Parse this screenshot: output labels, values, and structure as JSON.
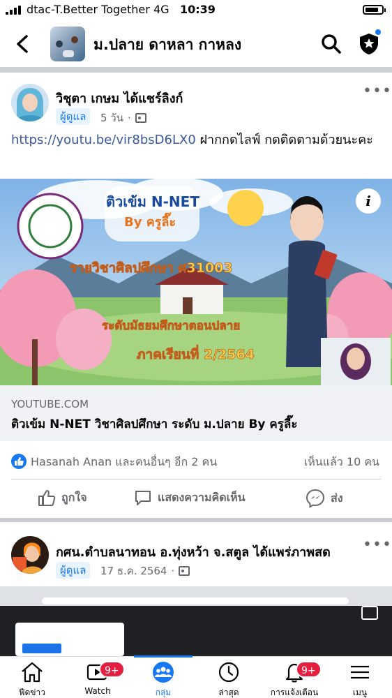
{
  "status_bar": {
    "carrier": "dtac-T.Better Together",
    "network": "4G",
    "time": "10:39"
  },
  "header": {
    "group_name": "ม.ปลาย ดาหลา กาหลง",
    "icons": [
      "back-arrow-icon",
      "search-icon",
      "admin-shield-icon"
    ]
  },
  "posts": [
    {
      "author": "วิชุตา เกษม",
      "action": "ได้แชร์ลิงก์",
      "badge": "ผู้ดูแล",
      "time": "5 วัน",
      "link_text": "https://youtu.be/vir8bsD6LX0",
      "text": " ฝากกดไลฟ์ กดติดตามด้วยนะคะ",
      "thumbnail": {
        "title": "ติวเข้ม N-NET",
        "subtitle": "By ครูลี๊ะ",
        "course": "รายวิชาศิลปศึกษา ศ31003",
        "level": "ระดับมัธยมศึกษาตอนปลาย",
        "term": "ภาคเรียนที่ 2/2564"
      },
      "link_domain": "YOUTUBE.COM",
      "link_title": "ติวเข้ม N-NET วิชาศิลปศึกษา ระดับ ม.ปลาย By ครูลี๊ะ",
      "reactions_text": "Hasanah Anan และคนอื่นๆ อีก 2 คน",
      "views_text": "เห็นแล้ว 10 คน",
      "actions": {
        "like": "ถูกใจ",
        "comment": "แสดงความคิดเห็น",
        "share": "ส่ง"
      }
    },
    {
      "author": "กศน.ตำบลนาทอน อ.ทุ่งหว้า จ.สตูล",
      "action": "ได้แพร่ภาพสด",
      "badge": "ผู้ดูแล",
      "time": "17 ธ.ค. 2564"
    }
  ],
  "bottom_nav": [
    {
      "label": "ฟีดข่าว",
      "icon": "home-icon",
      "badge": ""
    },
    {
      "label": "Watch",
      "icon": "watch-icon",
      "badge": "9+"
    },
    {
      "label": "กลุ่ม",
      "icon": "groups-icon",
      "badge": "",
      "active": true
    },
    {
      "label": "ล่าสุด",
      "icon": "clock-icon",
      "badge": ""
    },
    {
      "label": "การแจ้งเตือน",
      "icon": "bell-icon",
      "badge": "9+"
    },
    {
      "label": "เมนู",
      "icon": "menu-icon",
      "badge": ""
    }
  ],
  "colors": {
    "accent": "#1877f2",
    "badge_red": "#e41e3f",
    "secondary_text": "#65676b"
  }
}
